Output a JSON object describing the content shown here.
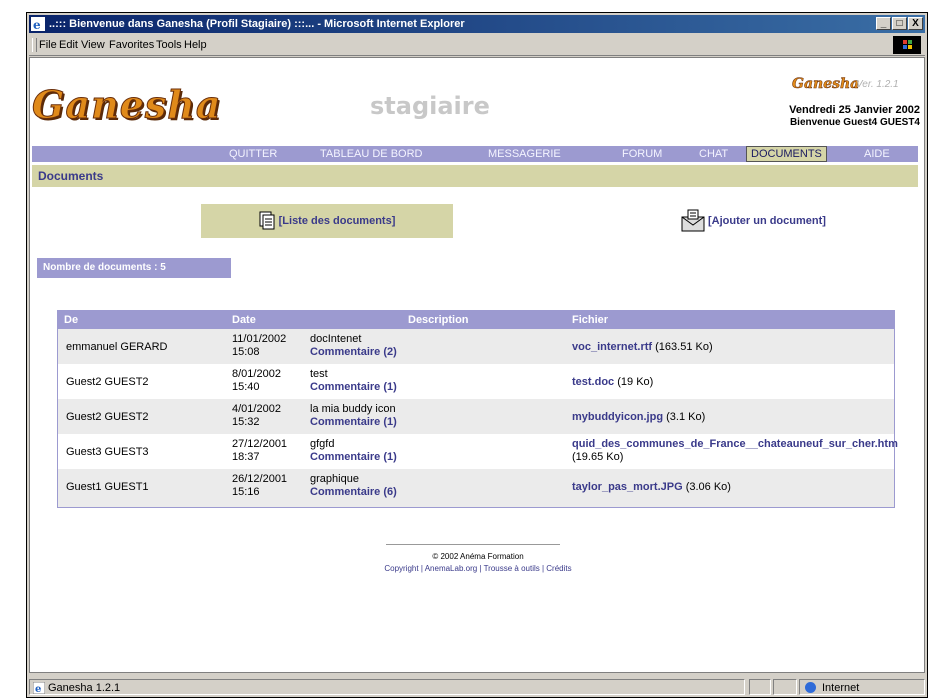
{
  "window": {
    "title": "..::: Bienvenue dans Ganesha (Profil Stagiaire) :::... - Microsoft Internet Explorer",
    "min": "_",
    "max": "□",
    "close": "X"
  },
  "menubar": {
    "items": [
      "File",
      "Edit",
      "View",
      "Favorites",
      "Tools",
      "Help"
    ]
  },
  "header": {
    "logo": "Ganesha",
    "role": "stagiaire",
    "small_logo": "Ganesha",
    "version": "Ver. 1.2.1",
    "date": "Vendredi 25 Janvier 2002",
    "welcome": "Bienvenue Guest4 GUEST4"
  },
  "nav": {
    "items": [
      "QUITTER",
      "TABLEAU DE BORD",
      "MESSAGERIE",
      "FORUM",
      "CHAT",
      "DOCUMENTS",
      "AIDE"
    ],
    "active": "DOCUMENTS"
  },
  "section": {
    "title": "Documents"
  },
  "actions": {
    "list": "[Liste des documents]",
    "add": "[Ajouter un document]"
  },
  "count": {
    "label": "Nombre de documents : 5"
  },
  "table": {
    "headers": {
      "de": "De",
      "date": "Date",
      "description": "Description",
      "fichier": "Fichier"
    },
    "rows": [
      {
        "de": "emmanuel GERARD",
        "date": "11/01/2002",
        "time": "15:08",
        "desc": "docIntenet",
        "comment": "Commentaire (2)",
        "file": "voc_internet.rtf",
        "size": " (163.51 Ko)"
      },
      {
        "de": "Guest2 GUEST2",
        "date": "8/01/2002",
        "time": "15:40",
        "desc": "test",
        "comment": "Commentaire (1)",
        "file": "test.doc",
        "size": " (19 Ko)"
      },
      {
        "de": "Guest2 GUEST2",
        "date": "4/01/2002",
        "time": "15:32",
        "desc": "la mia buddy icon",
        "comment": "Commentaire (1)",
        "file": "mybuddyicon.jpg",
        "size": " (3.1 Ko)"
      },
      {
        "de": "Guest3 GUEST3",
        "date": "27/12/2001",
        "time": "18:37",
        "desc": "gfgfd",
        "comment": "Commentaire (1)",
        "file": "quid_des_communes_de_France__chateauneuf_sur_cher.htm",
        "size": "(19.65 Ko)"
      },
      {
        "de": "Guest1 GUEST1",
        "date": "26/12/2001",
        "time": "15:16",
        "desc": "graphique",
        "comment": "Commentaire (6)",
        "file": "taylor_pas_mort.JPG",
        "size": " (3.06 Ko)"
      }
    ]
  },
  "footer": {
    "copyright": "© 2002 Anéma Formation",
    "link_copyright": "Copyright",
    "link_anemalab": "AnemaLab.org",
    "link_trousse": "Trousse à outils",
    "link_credits": "Crédits",
    "sep": " | "
  },
  "statusbar": {
    "text": "Ganesha 1.2.1",
    "zone": "Internet"
  },
  "colors": {
    "nav_bg": "#9c9ad0",
    "section_bg": "#d5d5a7",
    "link": "#3a3a8a",
    "logo": "#e08a1a"
  }
}
